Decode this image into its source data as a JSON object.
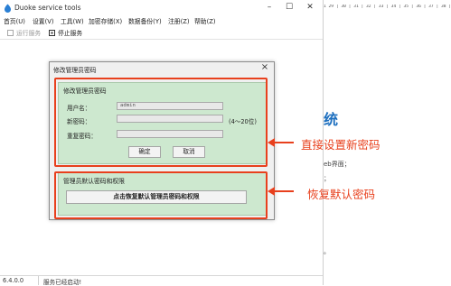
{
  "background_doc": {
    "ruler": "1 29 | 30 | 31 | 32 | 33 | 34 | 35 | 36 | 37 | 38 | 39 |",
    "heading": "统",
    "line1": "eb界面；",
    "line2": "；",
    "line3": "。"
  },
  "app": {
    "title": "Duoke service tools",
    "menu": [
      "首页(U)",
      "设置(V)",
      "工具(W)",
      "加密存储(X)",
      "数据备份(Y)",
      "注册(Z)",
      "帮助(Z)"
    ],
    "toolbar": {
      "run_label": "运行服务",
      "stop_label": "停止服务"
    },
    "status": {
      "version": "6.4.0.0",
      "text": "服务已经启动!"
    }
  },
  "dialog": {
    "title": "修改管理员密码",
    "change_group": {
      "legend": "修改管理员密码",
      "username_label": "用户名：",
      "username_value": "admin",
      "new_password_label": "新密码：",
      "repeat_password_label": "重复密码：",
      "length_hint": "(4～20位)",
      "ok_label": "确定",
      "cancel_label": "取消"
    },
    "reset_group": {
      "legend": "管理员默认密码和权限",
      "reset_button_label": "点击恢复默认管理员密码和权限"
    }
  },
  "annotations": {
    "set_new": "直接设置新密码",
    "restore_default": "恢复默认密码"
  },
  "colors": {
    "annotation_red": "#e8401d",
    "panel_green": "#cde8cf",
    "heading_blue": "#1d6fbf"
  }
}
